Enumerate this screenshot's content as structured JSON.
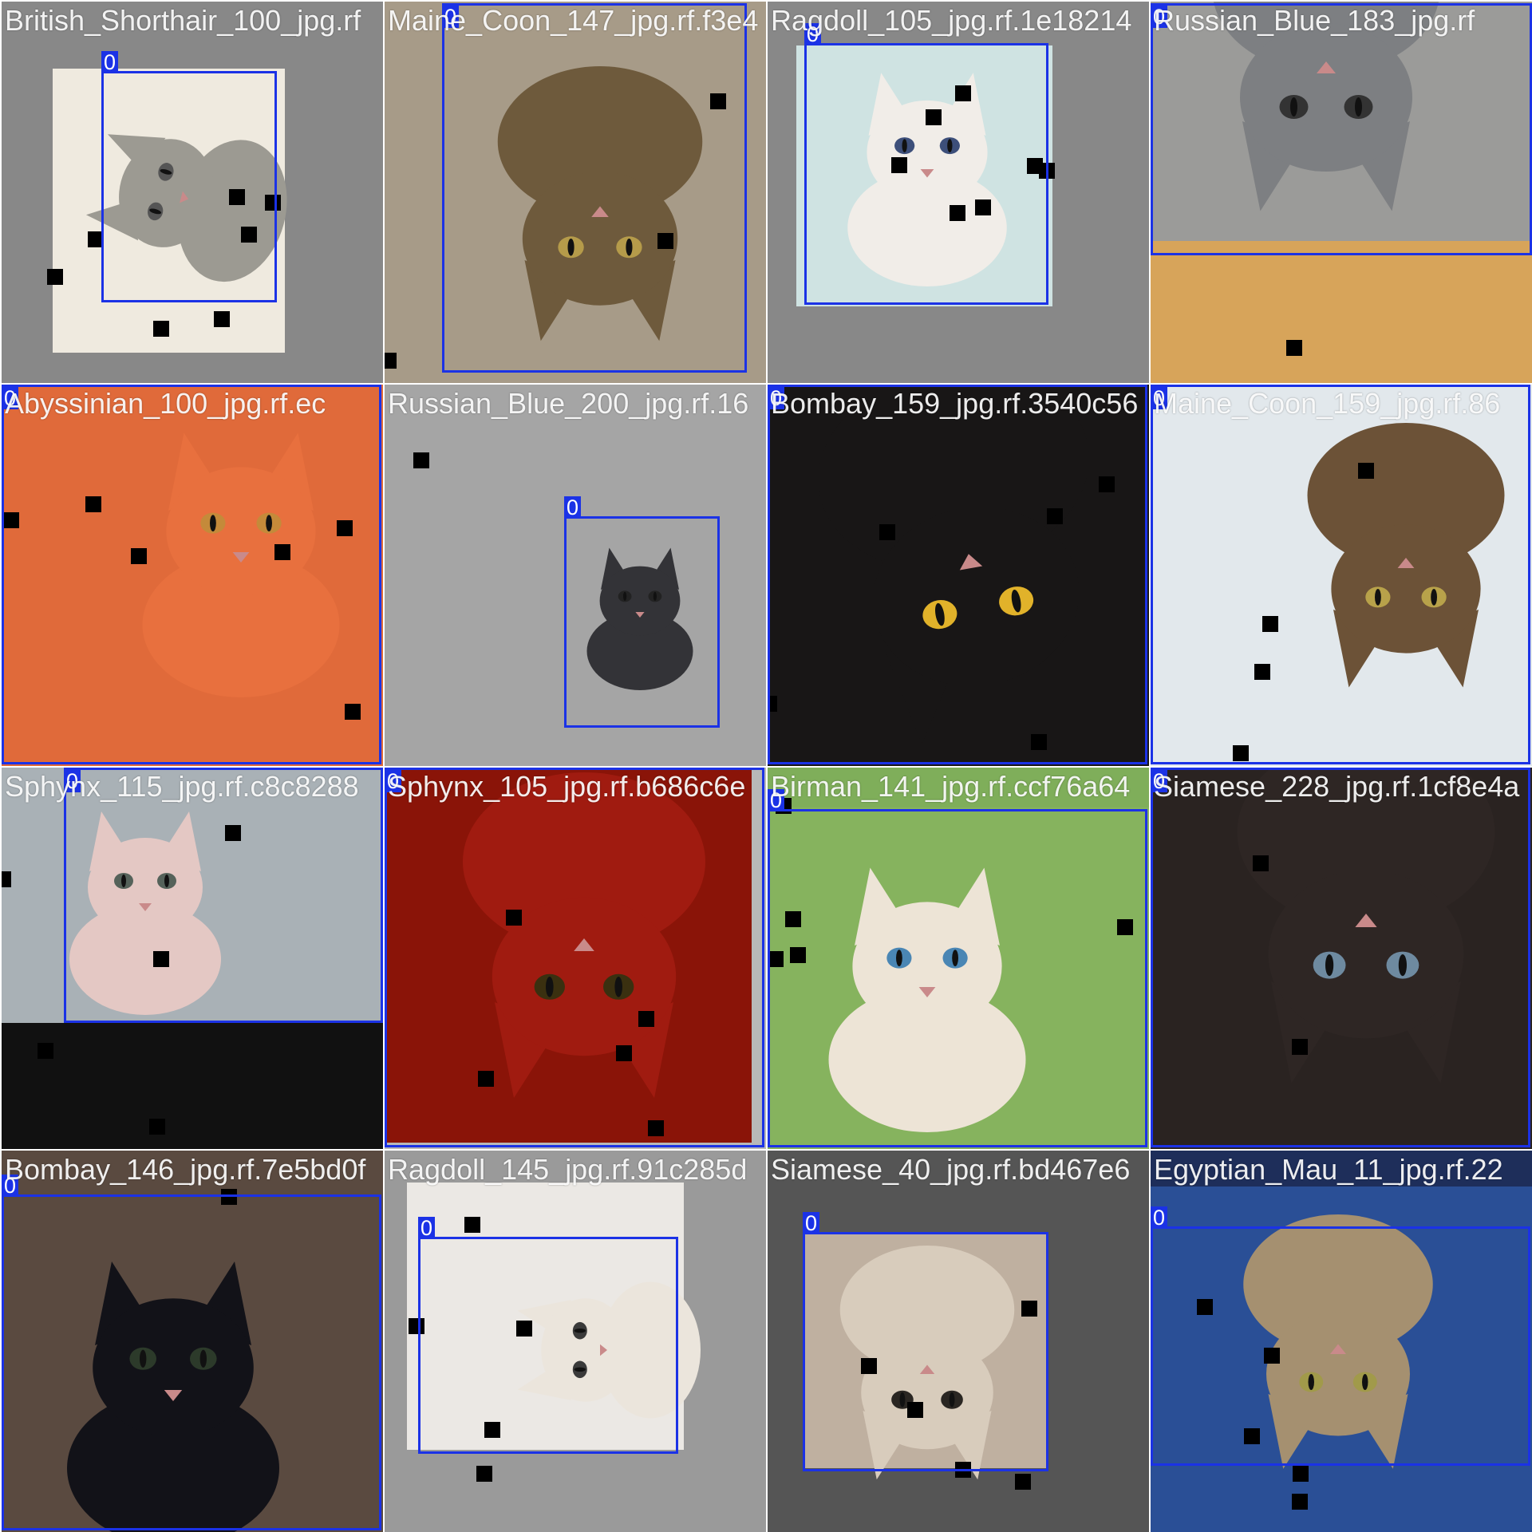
{
  "colors": {
    "box": "#1b32e6",
    "label_text": "#ffffff",
    "gutter": "#ffffff"
  },
  "tiles": [
    {
      "filename": "British_Shorthair_100_jpg.rf",
      "subject": "grey cat in a washed-out photo, rotated",
      "class_id": "0"
    },
    {
      "filename": "Maine_Coon_147_jpg.rf.f3e4",
      "subject": "upside-down tabby cat on carpet",
      "class_id": "0"
    },
    {
      "filename": "Ragdoll_105_jpg.rf.1e18214",
      "subject": "ragdoll kitten on a blanket",
      "class_id": "0"
    },
    {
      "filename": "Russian_Blue_183_jpg.rf",
      "subject": "grey cat upside down over a lit radiator",
      "class_id": "0"
    },
    {
      "filename": "Abyssinian_100_jpg.rf.ec",
      "subject": "orange-tinted cat close-up",
      "class_id": "0"
    },
    {
      "filename": "Russian_Blue_200_jpg.rf.16",
      "subject": "dark cat standing against grey wall",
      "class_id": "0"
    },
    {
      "filename": "Bombay_159_jpg.rf.3540c56",
      "subject": "black cat with yellow eyes, rotated",
      "class_id": "0"
    },
    {
      "filename": "Maine_Coon_159_jpg.rf.86",
      "subject": "tabby cat upside down by a snowy window",
      "class_id": "0"
    },
    {
      "filename": "Sphynx_115_jpg.rf.c8c8288",
      "subject": "hairless cat on a couch",
      "class_id": "0"
    },
    {
      "filename": "Sphynx_105_jpg.rf.b686c6e",
      "subject": "red-tinted inverted sphynx cat",
      "class_id": "0"
    },
    {
      "filename": "Birman_141_jpg.rf.ccf76a64",
      "subject": "birman cat lying in grass",
      "class_id": "0"
    },
    {
      "filename": "Siamese_228_jpg.rf.1cf8e4a",
      "subject": "dark siamese face upside down",
      "class_id": "0"
    },
    {
      "filename": "Bombay_146_jpg.rf.7e5bd0f",
      "subject": "black cat lying on a rug",
      "class_id": "0"
    },
    {
      "filename": "Ragdoll_145_jpg.rf.91c285d",
      "subject": "white cat sleeping on floral sheet",
      "class_id": "0"
    },
    {
      "filename": "Siamese_40_jpg.rf.bd467e6",
      "subject": "siamese cat face upside down",
      "class_id": "0"
    },
    {
      "filename": "Egyptian_Mau_11_jpg.rf.22",
      "subject": "spotted cat upside down on blue carpet",
      "class_id": "0"
    }
  ]
}
